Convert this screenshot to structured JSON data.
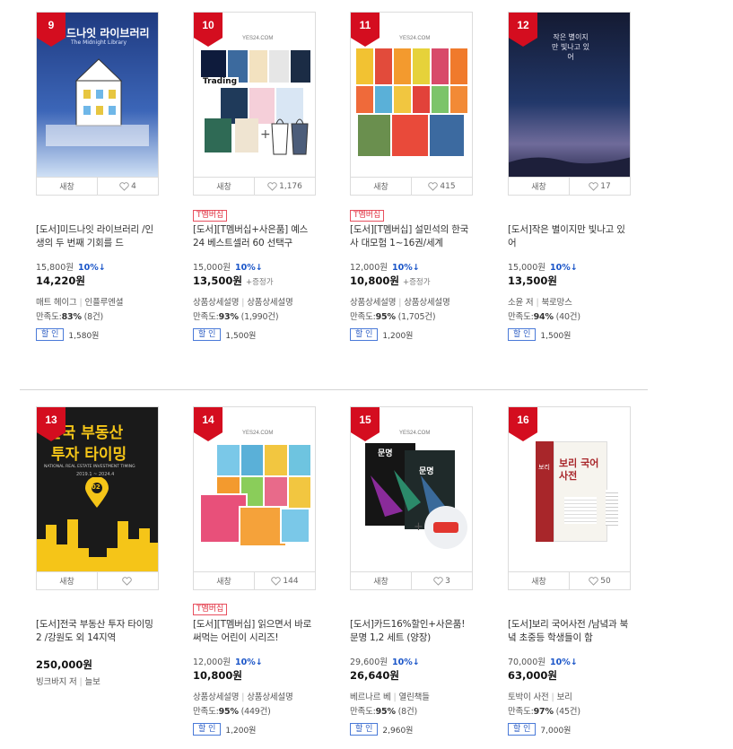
{
  "ui": {
    "preview_label": "새창",
    "discount_button_label": "할 인",
    "t_badge_label": "T멤버십"
  },
  "items": [
    {
      "rank": "9",
      "likes": "4",
      "cover_text": {
        "title": "미드나잇 라이브러리",
        "subtitle": "The Midnight Library"
      },
      "title": "[도서]미드나잇 라이브러리 /인생의 두 번째 기회를 드",
      "list_price": "15,800원",
      "rate": "10%↓",
      "sale_price": "14,220원",
      "sale_extra": "",
      "meta1": [
        "매트 헤이그",
        "인플루엔셜"
      ],
      "rating": "만족도:",
      "rating_pct": "83%",
      "rating_count": "(8건)",
      "discount": "1,580원"
    },
    {
      "rank": "10",
      "likes": "1,176",
      "badge": true,
      "cover_text": {
        "logo": "YES24.COM",
        "book": "Trading"
      },
      "title": "[도서][T멤버십+사은품] 예스24 베스트셀러 60 선택구",
      "list_price": "15,000원",
      "rate": "10%↓",
      "sale_price": "13,500원",
      "sale_extra": "+증정가",
      "meta1": [
        "상품상세설명",
        "상품상세설명"
      ],
      "rating": "만족도:",
      "rating_pct": "93%",
      "rating_count": "(1,990건)",
      "discount": "1,500원"
    },
    {
      "rank": "11",
      "likes": "415",
      "badge": true,
      "cover_text": {
        "logo": "YES24.COM"
      },
      "title": "[도서][T멤버십] 설민석의 한국사 대모험 1~16권/세계",
      "list_price": "12,000원",
      "rate": "10%↓",
      "sale_price": "10,800원",
      "sale_extra": "+증정가",
      "meta1": [
        "상품상세설명",
        "상품상세설명"
      ],
      "rating": "만족도:",
      "rating_pct": "95%",
      "rating_count": "(1,705건)",
      "discount": "1,200원"
    },
    {
      "rank": "12",
      "likes": "17",
      "cover_text": {
        "title": "작은 별이지만 빛나고 있어"
      },
      "title": "[도서]작은 별이지만 빛나고 있어",
      "list_price": "15,000원",
      "rate": "10%↓",
      "sale_price": "13,500원",
      "sale_extra": "",
      "meta1": [
        "소윤 저",
        "북로망스"
      ],
      "rating": "만족도:",
      "rating_pct": "94%",
      "rating_count": "(40건)",
      "discount": "1,500원"
    },
    {
      "rank": "13",
      "likes": "",
      "cover_text": {
        "title1": "한국 부동산",
        "title2": "투자 타이밍",
        "en": "NATIONAL REAL ESTATE INVESTMENT TIMING",
        "years": "2019.1 ~ 2024.4",
        "pin": "02"
      },
      "title": "[도서]전국 부동산 투자 타이밍 2 /강원도 외 14지역",
      "list_price": "",
      "rate": "",
      "sale_price": "250,000원",
      "sale_extra": "",
      "meta1": [
        "빙크바지 저",
        "늘보"
      ],
      "rating": "",
      "rating_pct": "",
      "rating_count": "",
      "discount": ""
    },
    {
      "rank": "14",
      "likes": "144",
      "badge": true,
      "cover_text": {
        "logo": "YES24.COM"
      },
      "title": "[도서][T멤버십] 읽으면서 바로 써먹는 어린이 시리즈!",
      "list_price": "12,000원",
      "rate": "10%↓",
      "sale_price": "10,800원",
      "sale_extra": "",
      "meta1": [
        "상품상세설명",
        "상품상세설명"
      ],
      "rating": "만족도:",
      "rating_pct": "95%",
      "rating_count": "(449건)",
      "discount": "1,200원"
    },
    {
      "rank": "15",
      "likes": "3",
      "cover_text": {
        "logo": "YES24.COM",
        "book": "문명"
      },
      "title": "[도서]카드16%할인+사은품! 문명 1,2 세트 (양장)",
      "list_price": "29,600원",
      "rate": "10%↓",
      "sale_price": "26,640원",
      "sale_extra": "",
      "meta1": [
        "베르나르 베",
        "열린책들"
      ],
      "rating": "만족도:",
      "rating_pct": "95%",
      "rating_count": "(8건)",
      "discount": "2,960원"
    },
    {
      "rank": "16",
      "likes": "50",
      "cover_text": {
        "brand": "보리",
        "title": "보리 국어 사전"
      },
      "title": "[도서]보리 국어사전 /남녘과 북녘 초중등 학생들이 함",
      "list_price": "70,000원",
      "rate": "10%↓",
      "sale_price": "63,000원",
      "sale_extra": "",
      "meta1": [
        "토박이 사전",
        "보리"
      ],
      "rating": "만족도:",
      "rating_pct": "97%",
      "rating_count": "(45건)",
      "discount": "7,000원"
    }
  ],
  "colors": {
    "rank_badge": "#d40d1f",
    "rate_text": "#1a55c8",
    "t_badge_border": "#e8505f",
    "discount_button_border": "#4a7ad8"
  }
}
